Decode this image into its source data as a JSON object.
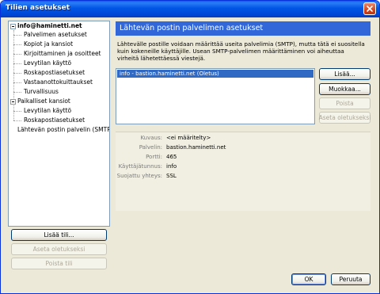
{
  "window": {
    "title": "Tilien asetukset"
  },
  "tree": {
    "accounts": [
      {
        "name": "info@haminetti.net",
        "children": [
          "Palvelimen asetukset",
          "Kopiot ja kansiot",
          "Kirjoittaminen ja osoitteet",
          "Levytilan käyttö",
          "Roskapostiasetukset",
          "Vastaanottokuittaukset",
          "Turvallisuus"
        ]
      },
      {
        "name": "Paikalliset kansiot",
        "children": [
          "Levytilan käyttö",
          "Roskapostiasetukset"
        ]
      }
    ],
    "smtp_item": "Lähtevän postin palvelin (SMTP)"
  },
  "left_buttons": {
    "add_account": "Lisää tili...",
    "set_default": "Aseta oletukseksi",
    "remove_account": "Poista tili"
  },
  "panel": {
    "heading": "Lähtevän postin palvelimen asetukset",
    "description": "Lähtevälle postille voidaan määrittää useita palvelimia (SMTP), mutta tätä ei suositella kuin kokeneille käyttäjille. Usean SMTP-palvelimen määrittäminen voi aiheuttaa virheitä lähetettäessä viestejä.",
    "servers": [
      "info - bastion.haminetti.net (Oletus)"
    ],
    "buttons": {
      "add": "Lisää...",
      "edit": "Muokkaa...",
      "remove": "Poista",
      "set_default": "Aseta oletukseksi"
    },
    "details": {
      "description_label": "Kuvaus:",
      "description_value": "<ei määritelty>",
      "server_label": "Palvelin:",
      "server_value": "bastion.haminetti.net",
      "port_label": "Portti:",
      "port_value": "465",
      "username_label": "Käyttäjätunnus:",
      "username_value": "info",
      "security_label": "Suojattu yhteys:",
      "security_value": "SSL"
    }
  },
  "footer": {
    "ok": "OK",
    "cancel": "Peruuta"
  },
  "colors": {
    "title_bar": "#0055e5",
    "heading_bar": "#3167d8",
    "selection": "#316ac5",
    "dialog_bg": "#ece9d8"
  }
}
